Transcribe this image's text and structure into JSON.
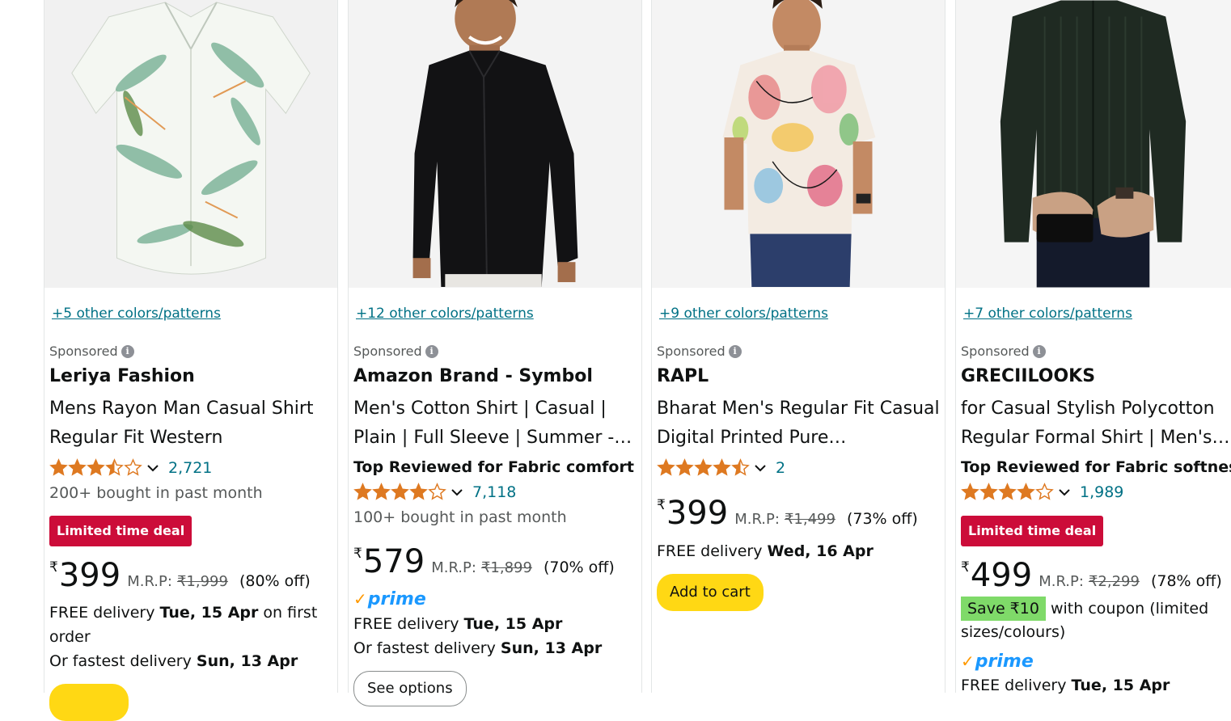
{
  "products": [
    {
      "colors": "+5 other colors/patterns",
      "sponsored": "Sponsored",
      "brand": "Leriya Fashion",
      "title": [
        "Mens Rayon Man Casual Shirt",
        "Regular Fit Western"
      ],
      "rating_value": 3.5,
      "rating_count": "2,721",
      "bought": "200+ bought in past month",
      "deal": "Limited time deal",
      "currency": "₹",
      "price": "399",
      "mrp_label": "M.R.P:",
      "mrp": "₹1,999",
      "off": "(80% off)",
      "delivery_1": {
        "pre": "FREE delivery ",
        "bold": "Tue, 15 Apr",
        "post": " on first"
      },
      "delivery_1b": "order",
      "delivery_2": {
        "pre": "Or fastest delivery ",
        "bold": "Sun, 13 Apr"
      }
    },
    {
      "colors": "+12 other colors/patterns",
      "sponsored": "Sponsored",
      "brand": "Amazon Brand - Symbol",
      "title": [
        "Men's Cotton Shirt | Casual |",
        "Plain | Full Sleeve | Summer -…"
      ],
      "badge": "Top Reviewed for Fabric comfort",
      "rating_value": 4.0,
      "rating_count": "7,118",
      "bought": "100+ bought in past month",
      "currency": "₹",
      "price": "579",
      "mrp_label": "M.R.P:",
      "mrp": "₹1,899",
      "off": "(70% off)",
      "prime": "prime",
      "delivery_1": {
        "pre": "FREE delivery ",
        "bold": "Tue, 15 Apr"
      },
      "delivery_2": {
        "pre": "Or fastest delivery ",
        "bold": "Sun, 13 Apr"
      },
      "button": "See options"
    },
    {
      "colors": "+9 other colors/patterns",
      "sponsored": "Sponsored",
      "brand": "RAPL",
      "title": [
        "Bharat Men's Regular Fit Casual",
        "Digital Printed Pure…"
      ],
      "rating_value": 4.5,
      "rating_count": "2",
      "currency": "₹",
      "price": "399",
      "mrp_label": "M.R.P:",
      "mrp": "₹1,499",
      "off": "(73% off)",
      "delivery_1": {
        "pre": "FREE delivery ",
        "bold": "Wed, 16 Apr"
      },
      "button": "Add to cart"
    },
    {
      "colors": "+7 other colors/patterns",
      "sponsored": "Sponsored",
      "brand": "GRECIILOOKS",
      "title": [
        "for Casual Stylish Polycotton",
        "Regular Formal Shirt | Men's…"
      ],
      "badge": "Top Reviewed for Fabric softness",
      "rating_value": 4.0,
      "rating_count": "1,989",
      "deal": "Limited time deal",
      "currency": "₹",
      "price": "499",
      "mrp_label": "M.R.P:",
      "mrp": "₹2,299",
      "off": "(78% off)",
      "coupon": "Save ₹10",
      "coupon_text": " with coupon (limited",
      "coupon_text_2": "sizes/colours)",
      "prime": "prime",
      "delivery_1": {
        "pre": "FREE delivery ",
        "bold": "Tue, 15 Apr"
      }
    }
  ],
  "colors": {
    "star": "#de7921",
    "link": "#007185",
    "deal": "#cc0c39",
    "cart": "#ffd814",
    "prime": "#1a98ff"
  }
}
